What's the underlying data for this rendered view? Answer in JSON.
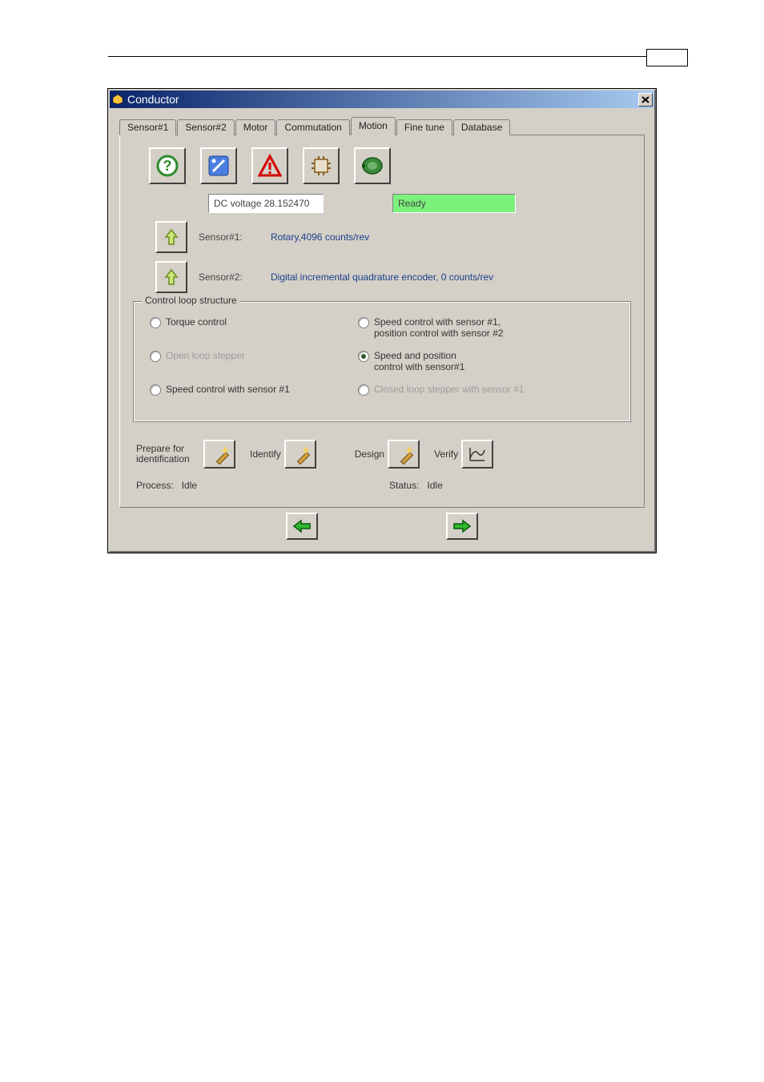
{
  "window": {
    "title": "Conductor",
    "close_icon": "close-icon"
  },
  "tabs": [
    "Sensor#1",
    "Sensor#2",
    "Motor",
    "Commutation",
    "Motion",
    "Fine tune",
    "Database"
  ],
  "active_tab_index": 4,
  "toolbar_icons": [
    "help-icon",
    "wizard-icon",
    "warning-icon",
    "io-icon",
    "motor-icon"
  ],
  "dc_voltage": {
    "label_prefix": "DC voltage",
    "value": "28.152470"
  },
  "ready_label": "Ready",
  "sensors": [
    {
      "label": "Sensor#1:",
      "desc": "Rotary,4096  counts/rev"
    },
    {
      "label": "Sensor#2:",
      "desc": "Digital incremental quadrature encoder, 0 counts/rev"
    }
  ],
  "group": {
    "title": "Control loop structure",
    "options": [
      {
        "label": "Torque control",
        "selected": false,
        "disabled": false
      },
      {
        "label": "Speed control with sensor #1,\nposition control with sensor #2",
        "selected": false,
        "disabled": false
      },
      {
        "label": "Open loop stepper",
        "selected": false,
        "disabled": true
      },
      {
        "label": "Speed and position\ncontrol with sensor#1",
        "selected": true,
        "disabled": false
      },
      {
        "label": "Speed control with sensor #1",
        "selected": false,
        "disabled": false
      },
      {
        "label": "Closed loop stepper with sensor #1",
        "selected": false,
        "disabled": true
      }
    ]
  },
  "actions": {
    "prepare": "Prepare for identification",
    "identify": "Identify",
    "design": "Design",
    "verify": "Verify"
  },
  "process": {
    "label": "Process:",
    "value": "Idle"
  },
  "status": {
    "label": "Status:",
    "value": "Idle"
  }
}
